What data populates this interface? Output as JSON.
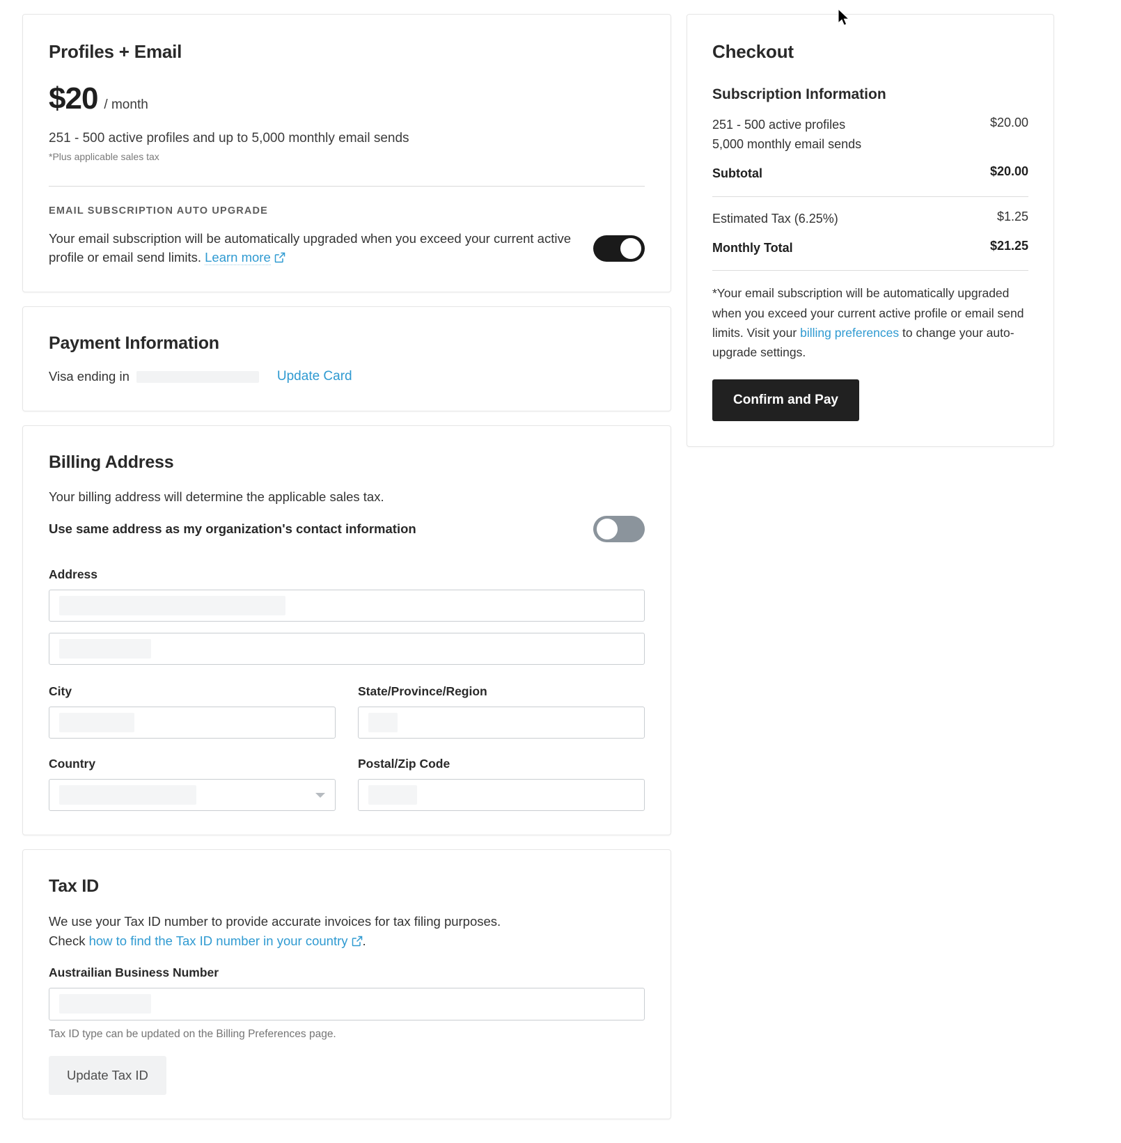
{
  "plan": {
    "title": "Profiles + Email",
    "price_amount": "$20",
    "price_period": "/ month",
    "description": "251 - 500 active profiles and up to 5,000 monthly email sends",
    "tax_note": "*Plus applicable sales tax",
    "auto_upgrade_eyebrow": "EMAIL SUBSCRIPTION AUTO UPGRADE",
    "auto_upgrade_text": "Your email subscription will be automatically upgraded when you exceed your current active profile or email send limits.",
    "learn_more_label": "Learn more",
    "auto_upgrade_toggle_state": "on"
  },
  "payment": {
    "title": "Payment Information",
    "card_label": "Visa ending in",
    "card_last4": "",
    "update_card_label": "Update Card"
  },
  "billing_address": {
    "title": "Billing Address",
    "description": "Your billing address will determine the applicable sales tax.",
    "same_address_label": "Use same address as my organization's contact information",
    "same_address_toggle_state": "off",
    "address_label": "Address",
    "address_line1_value": "",
    "address_line2_value": "",
    "city_label": "City",
    "city_value": "",
    "state_label": "State/Province/Region",
    "state_value": "",
    "country_label": "Country",
    "country_value": "",
    "postal_label": "Postal/Zip Code",
    "postal_value": ""
  },
  "tax_id": {
    "title": "Tax ID",
    "description_line1": "We use your Tax ID number to provide accurate invoices for tax filing purposes.",
    "description_check_prefix": "Check",
    "help_link_label": "how to find the Tax ID number in your country",
    "description_suffix": ".",
    "field_label": "Austrailian Business Number",
    "field_value": "",
    "hint": "Tax ID type can be updated on the Billing Preferences page.",
    "update_button_label": "Update Tax ID"
  },
  "checkout": {
    "title": "Checkout",
    "subscription_info_title": "Subscription Information",
    "line_items": [
      {
        "label_line1": "251 - 500 active profiles",
        "label_line2": "5,000 monthly email sends",
        "amount": "$20.00"
      }
    ],
    "subtotal_label": "Subtotal",
    "subtotal_amount": "$20.00",
    "tax_label": "Estimated Tax (6.25%)",
    "tax_amount": "$1.25",
    "total_label": "Monthly Total",
    "total_amount": "$21.25",
    "disclaimer_part1": "*Your email subscription will be automatically upgraded when you exceed your current active profile or email send limits. Visit your",
    "disclaimer_link": "billing preferences",
    "disclaimer_part2": "to change your auto-upgrade settings.",
    "confirm_button_label": "Confirm and Pay"
  },
  "colors": {
    "link": "#2f9ad1",
    "toggle_on": "#1a1a1a",
    "toggle_off": "#8b949c",
    "primary_button": "#212121"
  }
}
